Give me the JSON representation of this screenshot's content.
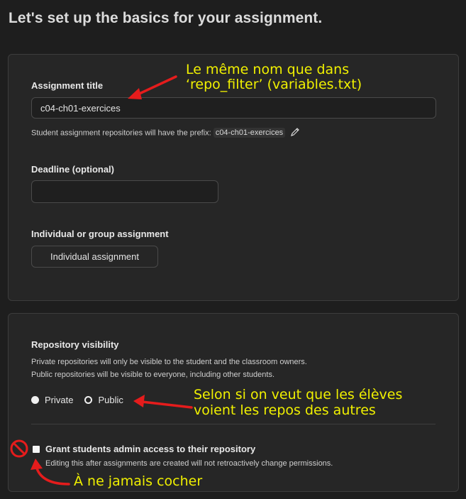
{
  "page": {
    "title": "Let's set up the basics for your assignment."
  },
  "assignment": {
    "title_label": "Assignment title",
    "title_value": "c04-ch01-exercices",
    "prefix_hint": "Student assignment repositories will have the prefix:",
    "prefix_value": "c04-ch01-exercices",
    "deadline_label": "Deadline (optional)",
    "deadline_value": "",
    "type_label": "Individual or group assignment",
    "type_value": "Individual assignment"
  },
  "visibility": {
    "label": "Repository visibility",
    "desc_private": "Private repositories will only be visible to the student and the classroom owners.",
    "desc_public": "Public repositories will be visible to everyone, including other students.",
    "options": [
      "Private",
      "Public"
    ],
    "selected": "Private"
  },
  "admin_access": {
    "label": "Grant students admin access to their repository",
    "hint": "Editing this after assignments are created will not retroactively change permissions."
  },
  "annotations": {
    "title_note_line1": "Le même nom que dans",
    "title_note_line2": "‘repo_filter’ (variables.txt)",
    "visibility_note_line1": "Selon si on veut que les élèves",
    "visibility_note_line2": "voient les repos des autres",
    "admin_note": "À ne jamais cocher"
  },
  "colors": {
    "annotation_text": "#f0f000",
    "annotation_arrow": "#e51c1c"
  },
  "icons": [
    "pencil-icon",
    "no-entry-icon"
  ]
}
